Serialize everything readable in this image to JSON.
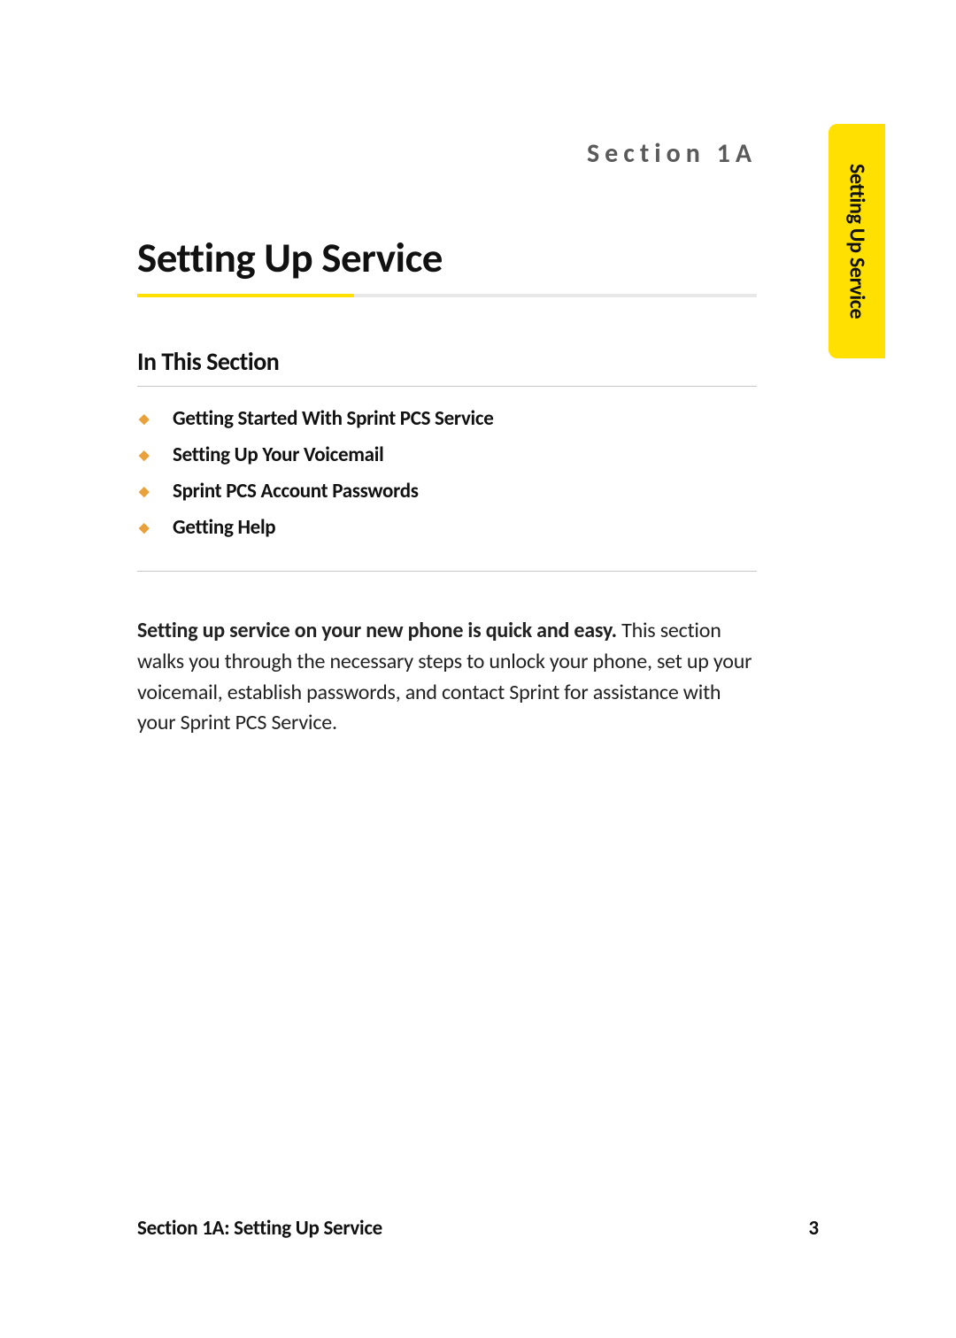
{
  "section_label": "Section 1A",
  "page_title": "Setting Up Service",
  "side_tab": "Setting Up Service",
  "subheading": "In This Section",
  "toc": {
    "items": [
      "Getting Started With Sprint PCS Service",
      "Setting Up Your Voicemail",
      "Sprint PCS Account Passwords",
      "Getting Help"
    ]
  },
  "body": {
    "lead": "Setting up service on your new phone is quick and easy. ",
    "text": "This section walks you through the necessary steps to unlock your phone, set up your voicemail, establish passwords, and contact Sprint for assistance with your Sprint PCS Service."
  },
  "footer": {
    "left": "Section 1A: Setting Up Service",
    "page": "3"
  },
  "bullet_glyph": "◆"
}
